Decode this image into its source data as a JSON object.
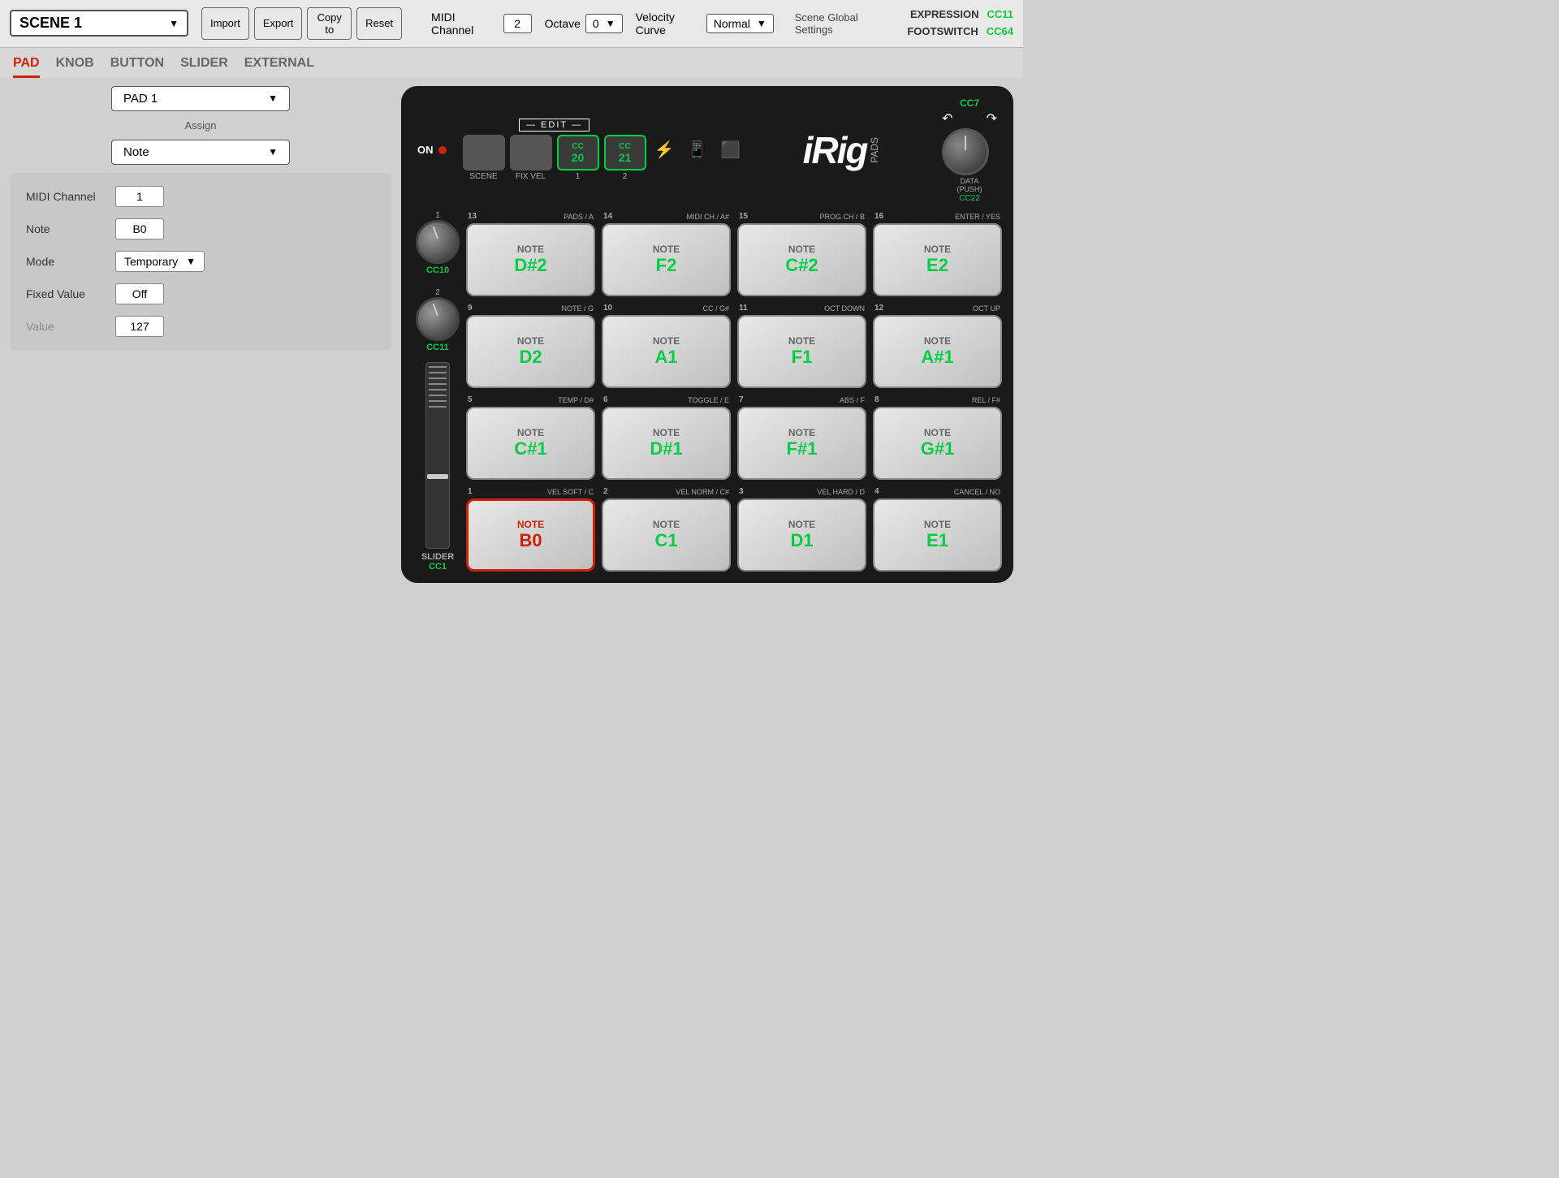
{
  "header": {
    "scene_name": "SCENE 1",
    "import_label": "Import",
    "export_label": "Export",
    "copy_to_label": "Copy to",
    "reset_label": "Reset",
    "midi_channel_label": "MIDI Channel",
    "midi_channel_value": "2",
    "octave_label": "Octave",
    "octave_value": "0",
    "velocity_curve_label": "Velocity Curve",
    "velocity_curve_value": "Normal",
    "scene_global_label": "Scene Global Settings",
    "expression_label": "EXPRESSION",
    "expression_value": "CC11",
    "footswitch_label": "FOOTSWITCH",
    "footswitch_value": "CC64"
  },
  "nav": {
    "tabs": [
      "PAD",
      "KNOB",
      "BUTTON",
      "SLIDER",
      "EXTERNAL"
    ],
    "active_tab": "PAD"
  },
  "left_panel": {
    "pad_select_label": "PAD 1",
    "assign_label": "Assign",
    "note_label": "Note",
    "params": {
      "midi_channel_label": "MIDI Channel",
      "midi_channel_value": "1",
      "note_label": "Note",
      "note_value": "B0",
      "mode_label": "Mode",
      "mode_value": "Temporary",
      "fixed_value_label": "Fixed Value",
      "fixed_value_value": "Off",
      "value_label": "Value",
      "value_value": "127"
    }
  },
  "device": {
    "edit_label": "— EDIT —",
    "on_label": "ON",
    "scene_btn_label": "SCENE",
    "fix_vel_btn_label": "FIX VEL",
    "cc20_label": "CC",
    "cc20_num": "20",
    "cc20_sub": "1",
    "cc21_label": "CC",
    "cc21_num": "21",
    "cc21_sub": "2",
    "irig_text": "iRig",
    "pads_text": "PADS",
    "cc7_label": "CC7",
    "data_push_label": "DATA\n(PUSH)\nCC22",
    "knob1_num": "1",
    "knob1_cc": "CC10",
    "knob2_num": "2",
    "knob2_cc": "CC11",
    "slider_label": "SLIDER",
    "slider_cc": "CC1",
    "pads": [
      {
        "num": "13",
        "func": "PADS / A",
        "type": "NOTE",
        "note": "D#2",
        "selected": false
      },
      {
        "num": "14",
        "func": "MIDI CH / A#",
        "type": "NOTE",
        "note": "F2",
        "selected": false
      },
      {
        "num": "15",
        "func": "PROG CH / B",
        "type": "NOTE",
        "note": "C#2",
        "selected": false
      },
      {
        "num": "16",
        "func": "ENTER / YES",
        "type": "NOTE",
        "note": "E2",
        "selected": false
      },
      {
        "num": "9",
        "func": "NOTE / G",
        "type": "NOTE",
        "note": "D2",
        "selected": false
      },
      {
        "num": "10",
        "func": "CC / G#",
        "type": "NOTE",
        "note": "A1",
        "selected": false
      },
      {
        "num": "11",
        "func": "OCT DOWN",
        "type": "NOTE",
        "note": "F1",
        "selected": false
      },
      {
        "num": "12",
        "func": "OCT UP",
        "type": "NOTE",
        "note": "A#1",
        "selected": false
      },
      {
        "num": "5",
        "func": "TEMP / D#",
        "type": "NOTE",
        "note": "C#1",
        "selected": false
      },
      {
        "num": "6",
        "func": "TOGGLE / E",
        "type": "NOTE",
        "note": "D#1",
        "selected": false
      },
      {
        "num": "7",
        "func": "ABS / F",
        "type": "NOTE",
        "note": "F#1",
        "selected": false
      },
      {
        "num": "8",
        "func": "REL / F#",
        "type": "NOTE",
        "note": "G#1",
        "selected": false
      },
      {
        "num": "1",
        "func": "VEL SOFT / C",
        "type": "NOTE",
        "note": "B0",
        "selected": true
      },
      {
        "num": "2",
        "func": "VEL NORM / C#",
        "type": "NOTE",
        "note": "C1",
        "selected": false
      },
      {
        "num": "3",
        "func": "VEL HARD / D",
        "type": "NOTE",
        "note": "D1",
        "selected": false
      },
      {
        "num": "4",
        "func": "CANCEL / NO",
        "type": "NOTE",
        "note": "E1",
        "selected": false
      }
    ]
  }
}
